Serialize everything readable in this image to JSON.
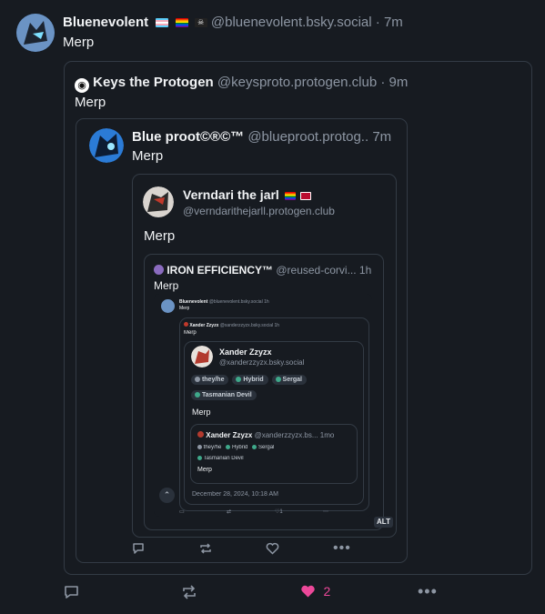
{
  "post": {
    "author_name": "Bluenevolent",
    "handle": "@bluenevolent.bsky.social",
    "time": "7m",
    "text": "Merp",
    "like_count": "2"
  },
  "quote1": {
    "author_name": "Keys the Protogen",
    "handle": "@keysproto.protogen.club",
    "time": "9m",
    "text": "Merp"
  },
  "quote2": {
    "author_name": "Blue proot©®©™",
    "handle": "@blueproot.protog..",
    "time": "7m",
    "text": "Merp"
  },
  "quote3": {
    "author_name": "Verndari the jarl",
    "handle": "@verndarithejarll.protogen.club",
    "text": "Merp"
  },
  "quote4": {
    "author_name": "IRON EFFICIENCY™",
    "handle": "@reused-corvi...",
    "time": "1h",
    "text": "Merp"
  },
  "mini": {
    "post_name": "Bluenevolent",
    "post_handle": "@bluenevolent.bsky.social",
    "post_time": "1h",
    "post_text": "Merp",
    "q_name": "Xander Zzyzx",
    "q_handle": "@xanderzzyzx.bsky.social",
    "q_time": "1h",
    "q_text": "Merp",
    "profile_name": "Xander Zzyzx",
    "profile_handle": "@xanderzzyzx.bsky.social",
    "tags": [
      "they/he",
      "Hybrid",
      "Sergal",
      "Tasmanian Devil"
    ],
    "profile_text": "Merp",
    "inner_name": "Xander Zzyzx",
    "inner_handle": "@xanderzzyzx.bs...",
    "inner_time": "1mo",
    "inner_tags": [
      "they/he",
      "Hybrid",
      "Sergal",
      "Tasmanian Devil"
    ],
    "inner_text": "Merp",
    "date": "December 28, 2024, 10:18 AM",
    "alt": "ALT"
  },
  "colors": {
    "background": "#171b21",
    "border": "#333b45",
    "muted": "#8d96a3",
    "like": "#ec4899"
  },
  "icons": {
    "reply": "speech-bubble-icon",
    "repost": "repost-arrows-icon",
    "like": "heart-icon",
    "more": "ellipsis-icon",
    "collapse": "chevron-up-icon"
  }
}
